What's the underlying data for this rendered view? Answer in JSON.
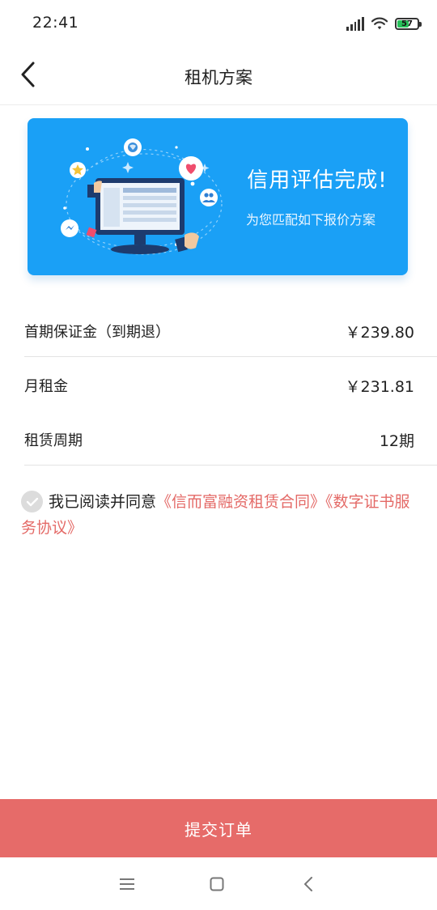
{
  "status_bar": {
    "time": "22:41",
    "battery": "57",
    "battery_level": 0.57,
    "icons": [
      "signal-icon",
      "wifi-icon",
      "battery-icon"
    ]
  },
  "header": {
    "title": "租机方案",
    "back_icon": "chevron-left-icon"
  },
  "banner": {
    "title": "信用评估完成!",
    "subtitle": "为您匹配如下报价方案",
    "illustration_icon": "computer-illustration"
  },
  "plan_rows": [
    {
      "label": "首期保证金（到期退）",
      "value": "￥239.80"
    },
    {
      "label": "月租金",
      "value": "￥231.81"
    },
    {
      "label": "租赁周期",
      "value": "12期"
    }
  ],
  "agreement": {
    "prefix": "我已阅读并同意",
    "contract_1": "《信而富融资租赁合同》",
    "contract_2": "《数字证书服务协议》",
    "checked": false
  },
  "submit_label": "提交订单",
  "nav_bar": {
    "icons": [
      "menu-icon",
      "home-square-icon",
      "back-triangle-icon"
    ]
  },
  "colors": {
    "accent": "#e66b69",
    "link": "#e46a67",
    "banner_blue": "#1aa0f6"
  }
}
